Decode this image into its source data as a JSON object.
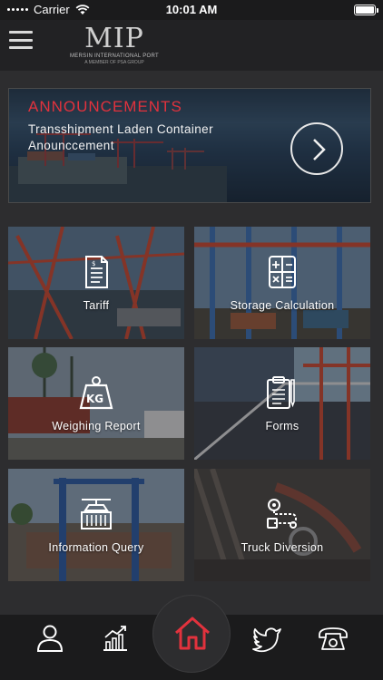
{
  "status_bar": {
    "carrier": "Carrier",
    "time": "10:01 AM"
  },
  "header": {
    "logo_mark": "MIP",
    "logo_line1": "MERSIN INTERNATIONAL PORT",
    "logo_line2": "A MEMBER OF PSA GROUP",
    "menu_icon": "hamburger-menu-icon"
  },
  "announcement": {
    "title": "ANNOUNCEMENTS",
    "text": "Transshipment Laden Container Anounccement",
    "arrow_icon": "chevron-right-icon"
  },
  "tiles": [
    {
      "label": "Tariff",
      "icon": "document-icon"
    },
    {
      "label": "Storage Calculation",
      "icon": "calculator-icon"
    },
    {
      "label": "Weighing Report",
      "icon": "weight-kg-icon"
    },
    {
      "label": "Forms",
      "icon": "clipboard-pen-icon"
    },
    {
      "label": "Information Query",
      "icon": "container-crane-icon"
    },
    {
      "label": "Truck Diversion",
      "icon": "route-icon"
    }
  ],
  "bottom_nav": [
    {
      "icon": "user-icon"
    },
    {
      "icon": "chart-icon"
    },
    {
      "icon": "home-icon",
      "active": true
    },
    {
      "icon": "twitter-icon"
    },
    {
      "icon": "phone-icon"
    }
  ],
  "colors": {
    "accent": "#e2323d",
    "background": "#2d2d2f",
    "bar": "#1b1b1c"
  }
}
